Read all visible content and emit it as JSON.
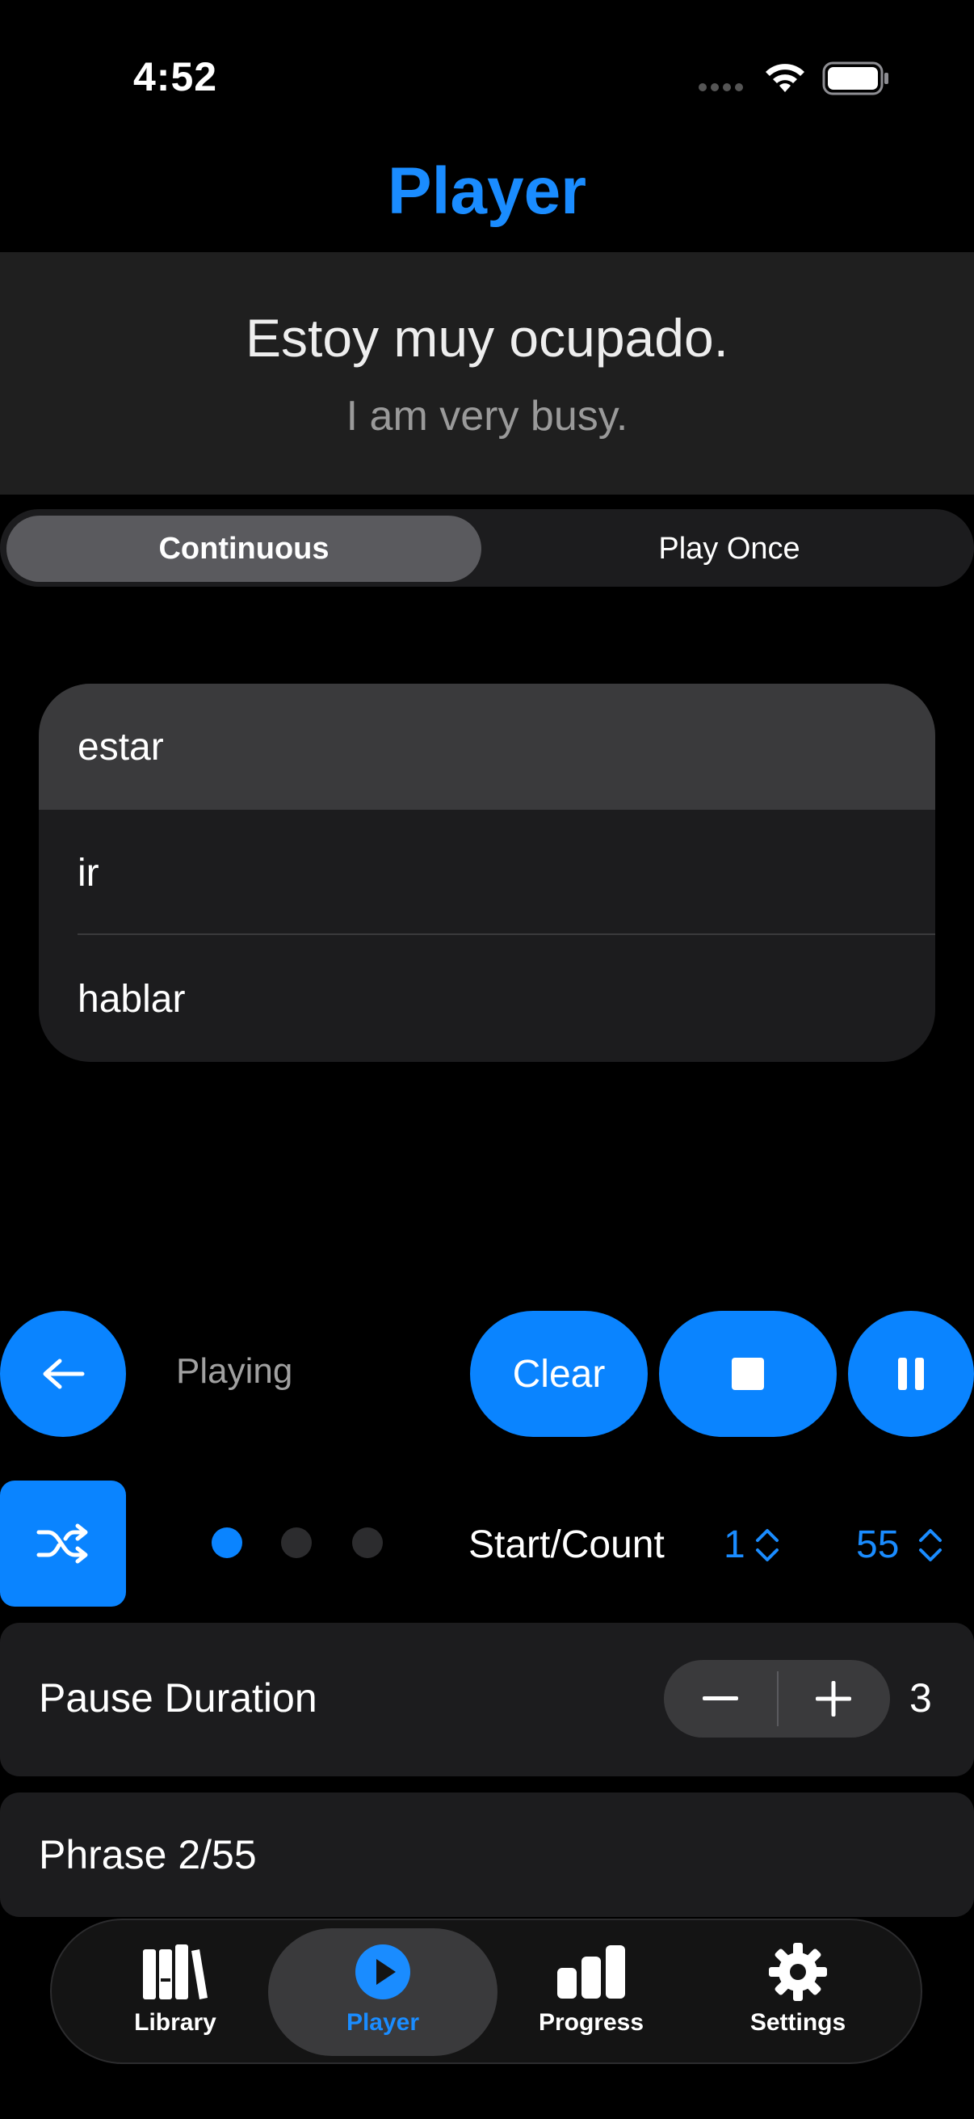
{
  "status_bar": {
    "time": "4:52"
  },
  "nav": {
    "title": "Player"
  },
  "phrase": {
    "spanish": "Estoy muy ocupado.",
    "english": "I am very busy."
  },
  "mode": {
    "options": [
      "Continuous",
      "Play Once"
    ],
    "selected": "Continuous"
  },
  "verbs": {
    "items": [
      "estar",
      "ir",
      "hablar"
    ],
    "selected": "estar"
  },
  "controls": {
    "status": "Playing",
    "clear_label": "Clear"
  },
  "pager": {
    "count": 3,
    "active_index": 0
  },
  "start_count": {
    "label": "Start/Count",
    "start": "1",
    "count": "55"
  },
  "pause_duration": {
    "label": "Pause Duration",
    "value": "3"
  },
  "phrase_progress": {
    "label": "Phrase 2/55"
  },
  "tabs": [
    {
      "label": "Library",
      "icon": "books-icon"
    },
    {
      "label": "Player",
      "icon": "play-circle-icon",
      "active": true
    },
    {
      "label": "Progress",
      "icon": "bar-chart-icon"
    },
    {
      "label": "Settings",
      "icon": "gear-icon"
    }
  ],
  "colors": {
    "accent": "#0a84ff",
    "background": "#000000",
    "card": "#1c1c1e"
  }
}
